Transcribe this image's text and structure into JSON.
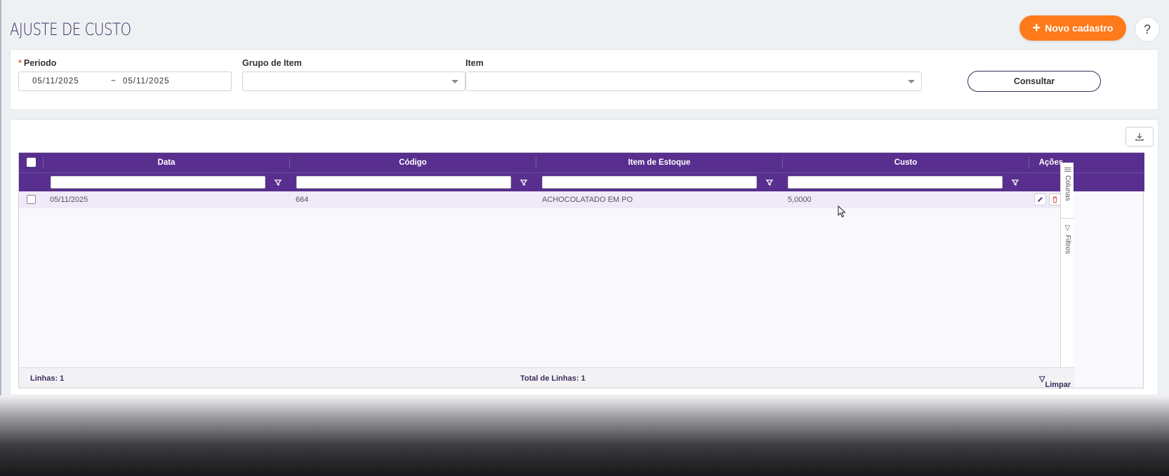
{
  "header": {
    "title": "AJUSTE DE CUSTO",
    "new_button_label": "Novo cadastro",
    "help_label": "?"
  },
  "filters": {
    "period": {
      "label": "Periodo",
      "required_mark": "*",
      "start": "05/11/2025",
      "separator": "~",
      "end": "05/11/2025"
    },
    "group": {
      "label": "Grupo de Item",
      "value": ""
    },
    "item": {
      "label": "Item",
      "value": ""
    },
    "consult_label": "Consultar"
  },
  "grid": {
    "columns": {
      "data": "Data",
      "codigo": "Código",
      "item": "Item de Estoque",
      "custo": "Custo",
      "acoes": "Ações"
    },
    "rows": [
      {
        "data": "05/11/2025",
        "codigo": "664",
        "item": "ACHOCOLATADO EM PO",
        "custo": "5,0000"
      }
    ],
    "side_tabs": {
      "columns": "Colunas",
      "filters": "Filtros"
    },
    "footer": {
      "lines": "Linhas: 1",
      "total": "Total de Linhas: 1",
      "clear": "Limpar"
    }
  },
  "colors": {
    "accent": "#ff7a1a",
    "grid_header": "#582f8e",
    "title": "#3c2a5c",
    "row_highlight": "#efe9f8"
  },
  "icons": [
    "plus-icon",
    "help-icon",
    "download-icon",
    "filter-icon",
    "edit-icon",
    "trash-icon",
    "columns-icon",
    "mouse-cursor-icon"
  ]
}
